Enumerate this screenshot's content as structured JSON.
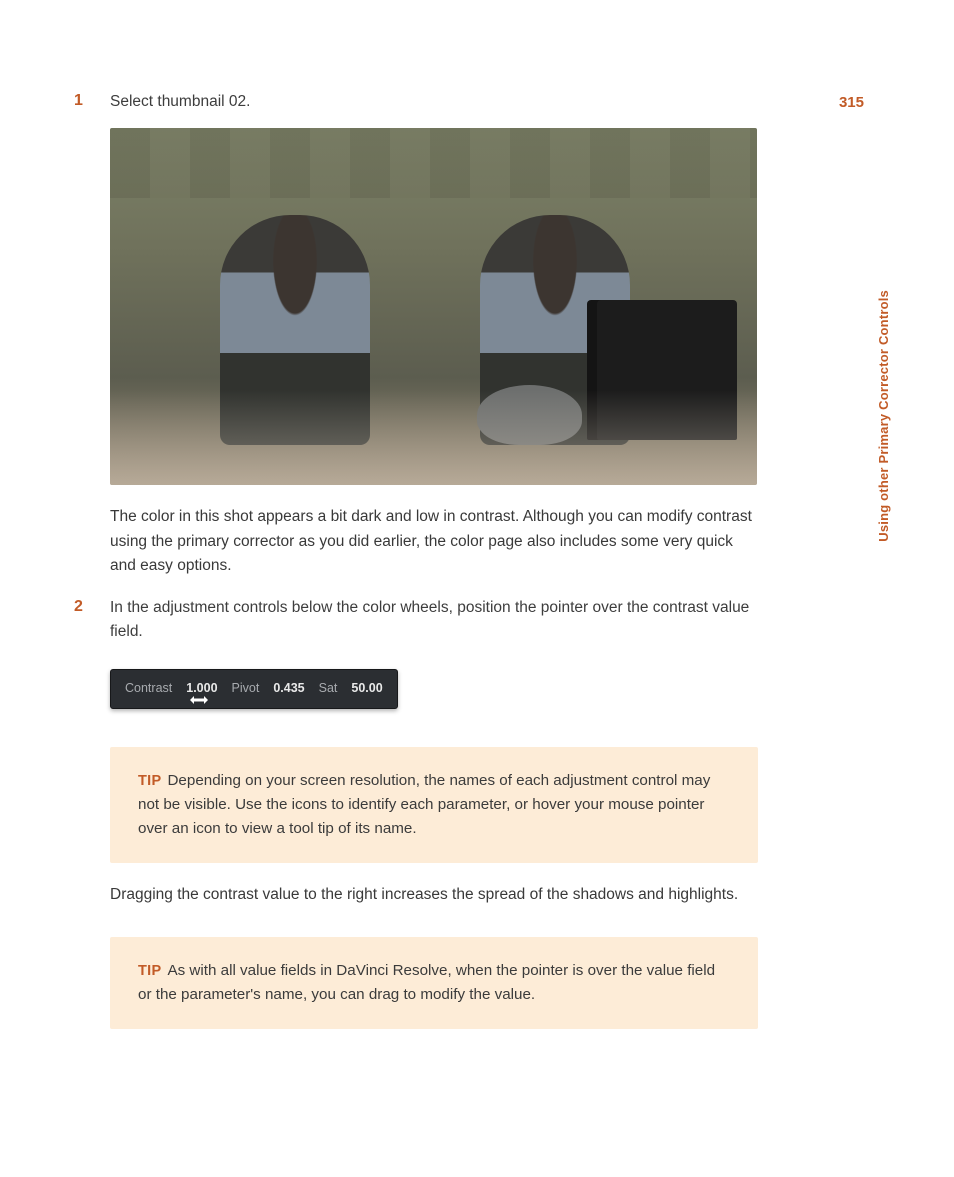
{
  "pageNumber": "315",
  "sideLabel": "Using other Primary Corrector Controls",
  "step1": {
    "num": "1",
    "text": "Select thumbnail 02."
  },
  "para1": "The color in this shot appears a bit dark and low in contrast. Although you can modify contrast using the primary corrector as you did earlier, the color page also includes some very quick and easy options.",
  "step2": {
    "num": "2",
    "text": "In the adjustment controls below the color wheels, position the pointer over the contrast value field."
  },
  "controls": {
    "contrast": {
      "label": "Contrast",
      "value": "1.000"
    },
    "pivot": {
      "label": "Pivot",
      "value": "0.435"
    },
    "sat": {
      "label": "Sat",
      "value": "50.00"
    }
  },
  "tip1": {
    "label": "TIP",
    "text": "Depending on your screen resolution, the names of each adjustment control may not be visible. Use the icons to identify each parameter, or hover your mouse pointer over an icon to view a tool tip of its name."
  },
  "para2": "Dragging the contrast value to the right increases the spread of the shadows and highlights.",
  "tip2": {
    "label": "TIP",
    "text": "As with all value fields in DaVinci Resolve, when the pointer is over the value field or the parameter's name, you can drag to modify the value."
  }
}
